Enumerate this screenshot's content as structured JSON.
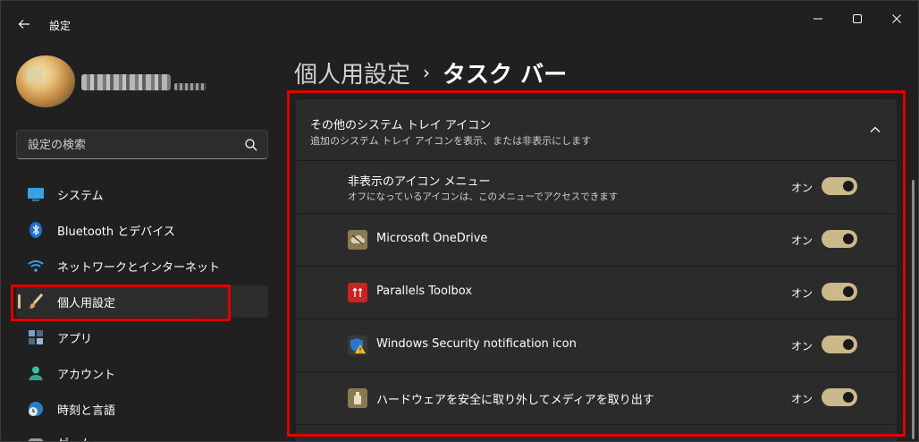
{
  "window": {
    "app_title": "設定",
    "controls": {
      "minimize": "minimize-icon",
      "maximize": "maximize-icon",
      "close": "close-icon"
    }
  },
  "profile": {
    "avatar_icon": "avatar",
    "username": ""
  },
  "search": {
    "placeholder": "設定の検索",
    "value": ""
  },
  "sidebar": {
    "items": [
      {
        "label": "システム",
        "icon": "system-icon",
        "selected": false
      },
      {
        "label": "Bluetooth とデバイス",
        "icon": "bluetooth-icon",
        "selected": false
      },
      {
        "label": "ネットワークとインターネット",
        "icon": "wifi-icon",
        "selected": false
      },
      {
        "label": "個人用設定",
        "icon": "brush-icon",
        "selected": true
      },
      {
        "label": "アプリ",
        "icon": "apps-icon",
        "selected": false
      },
      {
        "label": "アカウント",
        "icon": "account-icon",
        "selected": false
      },
      {
        "label": "時刻と言語",
        "icon": "time-language-icon",
        "selected": false
      },
      {
        "label": "ゲーム",
        "icon": "gaming-icon",
        "selected": false
      }
    ]
  },
  "breadcrumb": {
    "parent": "個人用設定",
    "separator": "›",
    "current": "タスク バー"
  },
  "group": {
    "title": "その他のシステム トレイ アイコン",
    "subtitle": "追加のシステム トレイ アイコンを表示、または非表示にします",
    "expanded": true
  },
  "rows": [
    {
      "label": "非表示のアイコン メニュー",
      "sub": "オフになっているアイコンは、このメニューでアクセスできます",
      "state": "オン",
      "on": true,
      "icon": ""
    },
    {
      "label": "Microsoft OneDrive",
      "sub": "",
      "state": "オン",
      "on": true,
      "icon": "onedrive-icon"
    },
    {
      "label": "Parallels Toolbox",
      "sub": "",
      "state": "オン",
      "on": true,
      "icon": "parallels-toolbox-icon"
    },
    {
      "label": "Windows Security notification icon",
      "sub": "",
      "state": "オン",
      "on": true,
      "icon": "windows-security-icon"
    },
    {
      "label": "ハードウェアを安全に取り外してメディアを取り出す",
      "sub": "",
      "state": "オン",
      "on": true,
      "icon": "usb-eject-icon"
    }
  ],
  "colors": {
    "background": "#202020",
    "card": "#2b2b2b",
    "accent": "#cbb98a",
    "highlight": "#e00000"
  }
}
